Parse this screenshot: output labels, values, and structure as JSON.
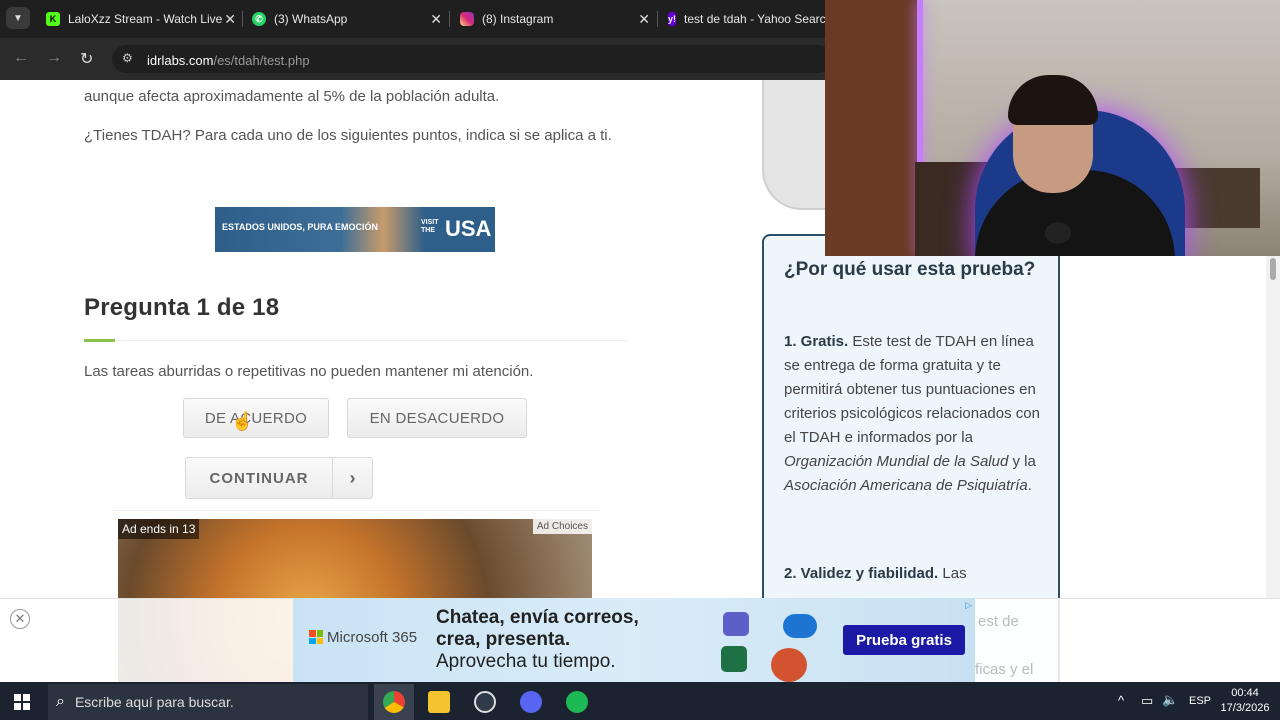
{
  "browser": {
    "tabs": [
      {
        "title": "LaloXzz Stream - Watch Live",
        "icon": "kick-icon",
        "color": "#53fc18"
      },
      {
        "title": "(3) WhatsApp",
        "icon": "whatsapp-icon",
        "color": "#25d366"
      },
      {
        "title": "(8) Instagram",
        "icon": "instagram-icon",
        "color": "#e1306c"
      },
      {
        "title": "test de tdah - Yahoo Search",
        "icon": "yahoo-icon",
        "color": "#6001d2"
      }
    ],
    "url_host": "idrlabs.com",
    "url_path": "/es/tdah/test.php"
  },
  "page": {
    "intro_line": "aunque afecta aproximadamente al 5% de la población adulta.",
    "question_prompt": "¿Tienes TDAH? Para cada uno de los siguientes puntos, indica si se aplica a ti.",
    "usa_ad_left": "ESTADOS UNIDOS, PURA EMOCIÓN",
    "usa_ad_visit": "VISIT THE",
    "usa_ad_brand": "USA",
    "question_heading": "Pregunta 1 de 18",
    "question_text": "Las tareas aburridas o repetitivas no pueden mantener mi atención.",
    "agree_label": "DE ACUERDO",
    "disagree_label": "EN DESACUERDO",
    "continue_label": "CONTINUAR",
    "video_ad_timer": "Ad ends in 13",
    "ad_choices": "Ad Choices"
  },
  "sidebar": {
    "title": "¿Por qué usar esta prueba?",
    "p1_bold": "1. Gratis.",
    "p1_text": "Este test de TDAH en línea se entrega de forma gratuita y te permitirá obtener tus puntuaciones en criterios psicológicos relacionados con el TDAH e informados por la",
    "p1_org1": "Organización Mundial de la Salud",
    "p1_and": "y la",
    "p1_org2": "Asociación Americana de Psiquiatría",
    "p1_end": ".",
    "p2_bold": "2. Validez y fiabilidad.",
    "p2_text": "Las"
  },
  "bottom_ad": {
    "brand": "Microsoft 365",
    "line1": "Chatea, envía correos,",
    "line2": "crea, presenta.",
    "line3": "Aprovecha tu tiempo.",
    "cta": "Prueba gratis",
    "peek1": "est de",
    "peek2": "ficas y el"
  },
  "taskbar": {
    "search_placeholder": "Escribe aquí para buscar.",
    "lang": "ESP",
    "time": "00:44",
    "date": "17/3/2026"
  }
}
